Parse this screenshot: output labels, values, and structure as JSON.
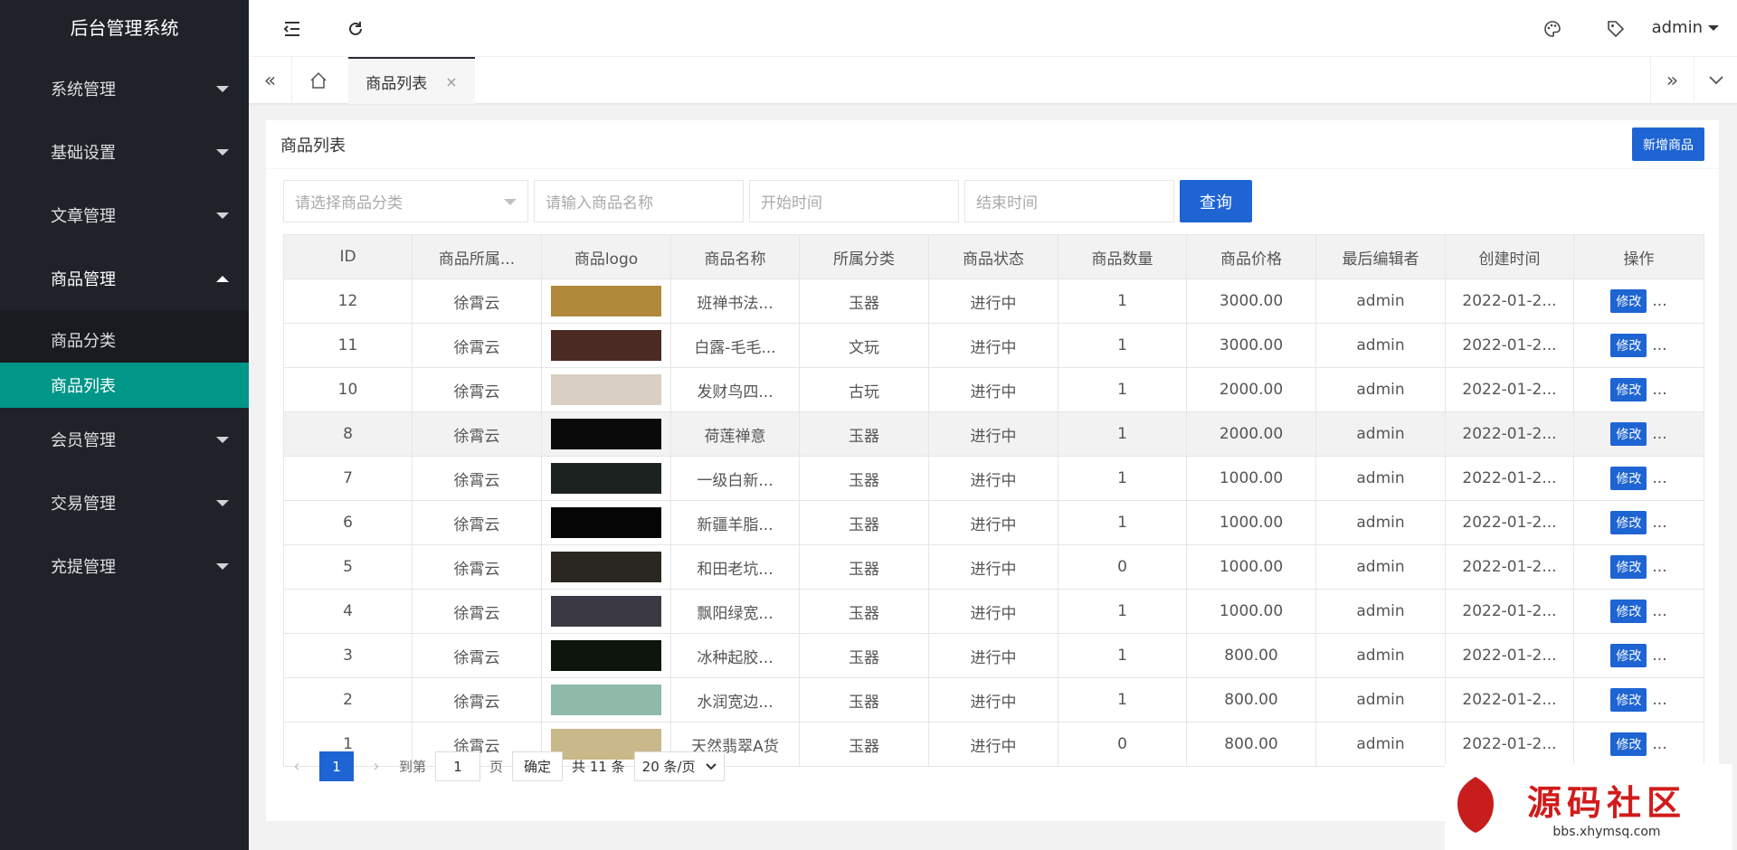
{
  "app": {
    "title": "后台管理系统"
  },
  "sidebar": {
    "items": [
      {
        "label": "系统管理"
      },
      {
        "label": "基础设置"
      },
      {
        "label": "文章管理"
      },
      {
        "label": "商品管理"
      },
      {
        "label": "会员管理"
      },
      {
        "label": "交易管理"
      },
      {
        "label": "充提管理"
      }
    ],
    "submenu": [
      {
        "label": "商品分类"
      },
      {
        "label": "商品列表"
      }
    ]
  },
  "header": {
    "user": "admin"
  },
  "tabs": [
    {
      "label": "商品列表",
      "close": "×"
    }
  ],
  "card": {
    "title": "商品列表",
    "add_button": "新增商品"
  },
  "filters": {
    "category_placeholder": "请选择商品分类",
    "name_placeholder": "请输入商品名称",
    "start_placeholder": "开始时间",
    "end_placeholder": "结束时间",
    "query_label": "查询"
  },
  "table": {
    "columns": [
      "ID",
      "商品所属...",
      "商品logo",
      "商品名称",
      "所属分类",
      "商品状态",
      "商品数量",
      "商品价格",
      "最后编辑者",
      "创建时间",
      "操作"
    ],
    "rows": [
      {
        "id": "12",
        "owner": "徐霄云",
        "name": "班禅书法...",
        "cat": "玉器",
        "status": "进行中",
        "qty": "1",
        "price": "3000.00",
        "editor": "admin",
        "time": "2022-01-2...",
        "thumb": "#b08a3a"
      },
      {
        "id": "11",
        "owner": "徐霄云",
        "name": "白露-毛毛...",
        "cat": "文玩",
        "status": "进行中",
        "qty": "1",
        "price": "3000.00",
        "editor": "admin",
        "time": "2022-01-2...",
        "thumb": "#4a2a22"
      },
      {
        "id": "10",
        "owner": "徐霄云",
        "name": "发财鸟四...",
        "cat": "古玩",
        "status": "进行中",
        "qty": "1",
        "price": "2000.00",
        "editor": "admin",
        "time": "2022-01-2...",
        "thumb": "#d9cfc2"
      },
      {
        "id": "8",
        "owner": "徐霄云",
        "name": "荷莲禅意",
        "cat": "玉器",
        "status": "进行中",
        "qty": "1",
        "price": "2000.00",
        "editor": "admin",
        "time": "2022-01-2...",
        "thumb": "#0a0a0a"
      },
      {
        "id": "7",
        "owner": "徐霄云",
        "name": "一级白新...",
        "cat": "玉器",
        "status": "进行中",
        "qty": "1",
        "price": "1000.00",
        "editor": "admin",
        "time": "2022-01-2...",
        "thumb": "#1c2220"
      },
      {
        "id": "6",
        "owner": "徐霄云",
        "name": "新疆羊脂...",
        "cat": "玉器",
        "status": "进行中",
        "qty": "1",
        "price": "1000.00",
        "editor": "admin",
        "time": "2022-01-2...",
        "thumb": "#050505"
      },
      {
        "id": "5",
        "owner": "徐霄云",
        "name": "和田老坑...",
        "cat": "玉器",
        "status": "进行中",
        "qty": "0",
        "price": "1000.00",
        "editor": "admin",
        "time": "2022-01-2...",
        "thumb": "#2a2722"
      },
      {
        "id": "4",
        "owner": "徐霄云",
        "name": "飘阳绿宽...",
        "cat": "玉器",
        "status": "进行中",
        "qty": "1",
        "price": "1000.00",
        "editor": "admin",
        "time": "2022-01-2...",
        "thumb": "#3b3a44"
      },
      {
        "id": "3",
        "owner": "徐霄云",
        "name": "冰种起胶...",
        "cat": "玉器",
        "status": "进行中",
        "qty": "1",
        "price": "800.00",
        "editor": "admin",
        "time": "2022-01-2...",
        "thumb": "#0d150d"
      },
      {
        "id": "2",
        "owner": "徐霄云",
        "name": "水润宽边...",
        "cat": "玉器",
        "status": "进行中",
        "qty": "1",
        "price": "800.00",
        "editor": "admin",
        "time": "2022-01-2...",
        "thumb": "#8fb9a9"
      },
      {
        "id": "1",
        "owner": "徐霄云",
        "name": "天然翡翠A货",
        "cat": "玉器",
        "status": "进行中",
        "qty": "0",
        "price": "800.00",
        "editor": "admin",
        "time": "2022-01-2...",
        "thumb": "#c9b98a"
      }
    ],
    "edit_label": "修改",
    "more_label": "..."
  },
  "pager": {
    "current": "1",
    "goto_label": "到第",
    "goto_value": "1",
    "page_label": "页",
    "confirm_label": "确定",
    "total": "共 11 条",
    "per_page": "20 条/页"
  },
  "watermark": {
    "title": "源码社区",
    "url": "bbs.xhymsq.com"
  }
}
